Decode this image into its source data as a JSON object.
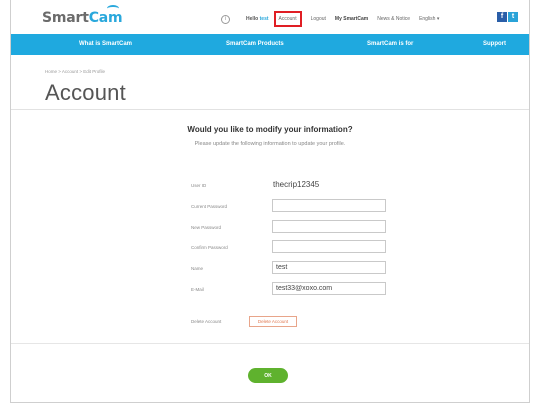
{
  "header": {
    "logo_smart": "Smart",
    "logo_cam": "Cam",
    "hello_prefix": "Hello",
    "hello_name": "test",
    "account": "Account",
    "logout": "Logout",
    "my_smartcam": "My SmartCam",
    "news": "News & Notice",
    "language": "English",
    "facebook": "f",
    "twitter": "t"
  },
  "mainnav": {
    "items": [
      "What is SmartCam",
      "SmartCam Products",
      "SmartCam is for",
      "Support"
    ]
  },
  "breadcrumb": "Home > Account > Edit Profile",
  "page_title": "Account",
  "intro": {
    "question": "Would you like to modify your information?",
    "subtext": "Please update the following information to update your profile."
  },
  "form": {
    "user_id_label": "User ID",
    "user_id_value": "thecrip12345",
    "current_password_label": "Current Password",
    "current_password_value": "",
    "new_password_label": "New Password",
    "new_password_value": "",
    "confirm_password_label": "Confirm Password",
    "confirm_password_value": "",
    "name_label": "Name",
    "name_value": "test",
    "email_label": "E-Mail",
    "email_value": "test33@xoxo.com",
    "delete_label": "Delete Account",
    "delete_button": "Delete Account"
  },
  "ok_button": "OK",
  "colors": {
    "accent": "#1fa9df",
    "highlight": "#e01e24",
    "ok": "#5fb22e"
  }
}
